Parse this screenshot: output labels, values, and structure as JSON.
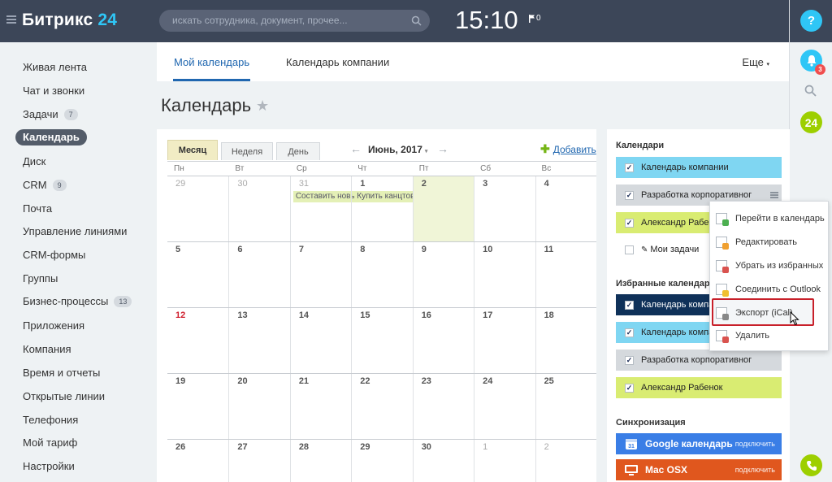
{
  "topbar": {
    "logo_name": "Битрикс",
    "logo_num": "24",
    "search_placeholder": "искать сотрудника, документ, прочее...",
    "clock": "15:10",
    "flag_count": "0"
  },
  "rail": {
    "help": "?",
    "bell_badge": "3",
    "b24": "24"
  },
  "menu": {
    "items": [
      {
        "label": "Живая лента"
      },
      {
        "label": "Чат и звонки"
      },
      {
        "label": "Задачи",
        "count": "7"
      },
      {
        "label": "Календарь",
        "active": true
      },
      {
        "label": "Диск"
      },
      {
        "label": "CRM",
        "count": "9"
      },
      {
        "label": "Почта"
      },
      {
        "label": "Управление линиями"
      },
      {
        "label": "CRM-формы"
      },
      {
        "label": "Группы"
      },
      {
        "label": "Бизнес-процессы",
        "count": "13"
      },
      {
        "label": "Приложения"
      },
      {
        "label": "Компания"
      },
      {
        "label": "Время и отчеты"
      },
      {
        "label": "Открытые линии"
      },
      {
        "label": "Телефония"
      },
      {
        "label": "Мой тариф"
      },
      {
        "label": "Настройки"
      }
    ]
  },
  "tabs": {
    "my": "Мой календарь",
    "company": "Календарь компании",
    "more": "Еще"
  },
  "page": {
    "title": "Календарь"
  },
  "calendar": {
    "views": {
      "month": "Месяц",
      "week": "Неделя",
      "day": "День"
    },
    "period": "Июнь, 2017",
    "add": "Добавить",
    "weekdays": [
      "Пн",
      "Вт",
      "Ср",
      "Чт",
      "Пт",
      "Сб",
      "Вс"
    ],
    "weeks": [
      [
        "29",
        "30",
        "31",
        "1",
        "2",
        "3",
        "4"
      ],
      [
        "5",
        "6",
        "7",
        "8",
        "9",
        "10",
        "11"
      ],
      [
        "12",
        "13",
        "14",
        "15",
        "16",
        "17",
        "18"
      ],
      [
        "19",
        "20",
        "21",
        "22",
        "23",
        "24",
        "25"
      ],
      [
        "26",
        "27",
        "28",
        "29",
        "30",
        "1",
        "2"
      ]
    ],
    "events": [
      {
        "week": 0,
        "day": 2,
        "title": "Составить новый"
      },
      {
        "week": 0,
        "day": 3,
        "title": "Купить канцтовар"
      }
    ]
  },
  "sidebar": {
    "calendars_title": "Календари",
    "calendars": [
      {
        "name": "Календарь компании",
        "color": "#7fd6f2",
        "checked": true
      },
      {
        "name": "Разработка корпоративног",
        "color": "#d5d9dd",
        "checked": true
      },
      {
        "name": "Александр Рабенок",
        "color": "#d9ec72",
        "checked": true
      }
    ],
    "my_tasks": "Мои задачи",
    "fav_title": "Избранные календари",
    "favorites": [
      {
        "name": "Календарь компании",
        "color": "#0f3159",
        "checked": true
      },
      {
        "name": "Календарь компании",
        "color": "#7fd6f2",
        "checked": true
      },
      {
        "name": "Разработка корпоративног",
        "color": "#d5d9dd",
        "checked": true
      },
      {
        "name": "Александр Рабенок",
        "color": "#d9ec72",
        "checked": true
      }
    ],
    "sync_title": "Синхронизация",
    "sync": [
      {
        "name": "Google календарь",
        "action": "подключить",
        "color": "#3a7ee6"
      },
      {
        "name": "Mac OSX",
        "action": "подключить",
        "color": "#e0571e"
      }
    ]
  },
  "context_menu": {
    "items": [
      {
        "label": "Перейти в календарь",
        "mark": "#4caf50"
      },
      {
        "label": "Редактировать",
        "mark": "#f0a030"
      },
      {
        "label": "Убрать из избранных",
        "mark": "#d9534f"
      },
      {
        "label": "Соединить с Outlook",
        "mark": "#f0c030"
      },
      {
        "label": "Экспорт (iCal)",
        "mark": "#888888"
      },
      {
        "label": "Удалить",
        "mark": "#d9534f"
      }
    ]
  }
}
